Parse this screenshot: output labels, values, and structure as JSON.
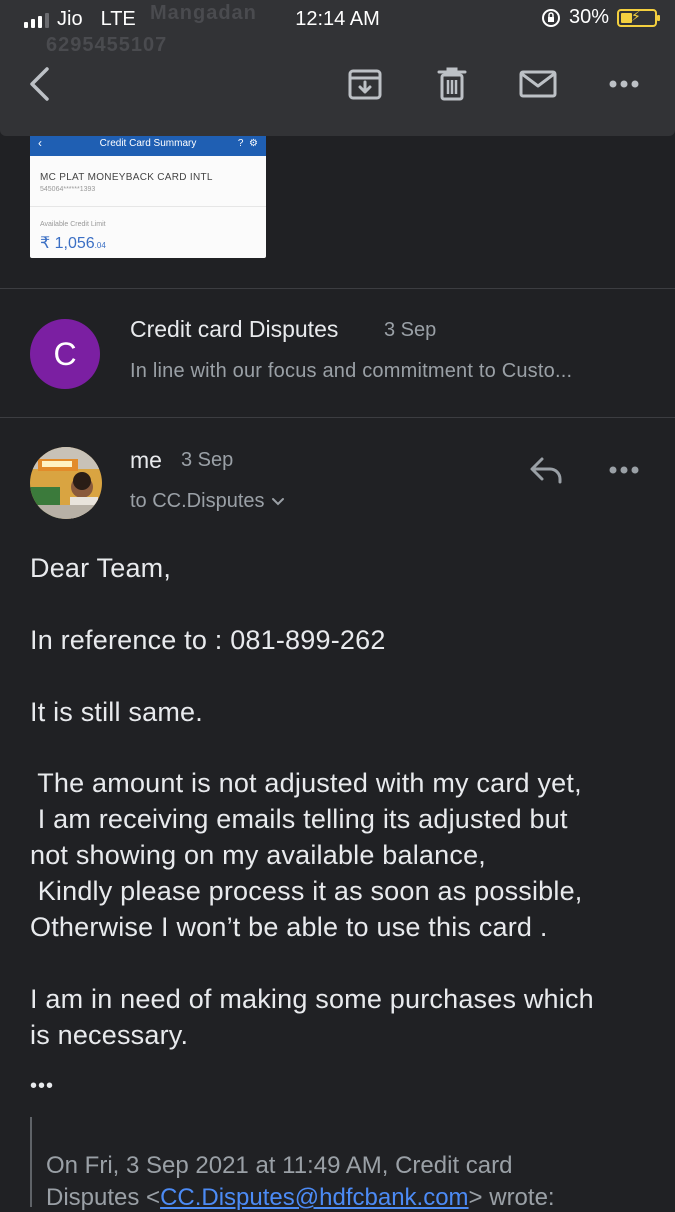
{
  "status_bar": {
    "carrier": "Jio",
    "network": "LTE",
    "time": "12:14 AM",
    "battery_percent": "30%"
  },
  "toolbar": {
    "back_icon": "chevron-left-icon",
    "archive_icon": "archive-icon",
    "delete_icon": "trash-icon",
    "mark_unread_icon": "mail-icon",
    "more_icon": "more-horizontal-icon"
  },
  "attachment_preview": {
    "header": "Credit Card Summary",
    "card_name": "MC PLAT MONEYBACK CARD INTL",
    "card_number": "545064******1393",
    "available_label": "Available Credit Limit",
    "amount": "₹ 1,056",
    "amount_decimal": ".04"
  },
  "collapsed_message": {
    "avatar_letter": "C",
    "sender": "Credit card Disputes",
    "date": "3 Sep",
    "snippet": "In line with our focus and commitment to Custo..."
  },
  "open_message": {
    "sender": "me",
    "date": "3 Sep",
    "recipient": "to CC.Disputes",
    "body": {
      "greeting": "Dear Team,",
      "reference": "In reference to : 081-899-262",
      "line1": "It is still same.",
      "para2": " The amount is not adjusted with my card yet,\n I am receiving emails telling its adjusted but\nnot showing on my available balance,\n Kindly please process it as soon as possible,\nOtherwise I won’t be able to use this card .",
      "para3": "I am in need of making some purchases which\nis necessary.",
      "ellipsis": "•••"
    },
    "quote": {
      "line1": "On Fri, 3 Sep 2021 at 11:49 AM, Credit card",
      "line2_prefix": "Disputes <",
      "line2_link": "CC.Disputes@hdfcbank.com",
      "line2_suffix": "> wrote:"
    }
  }
}
